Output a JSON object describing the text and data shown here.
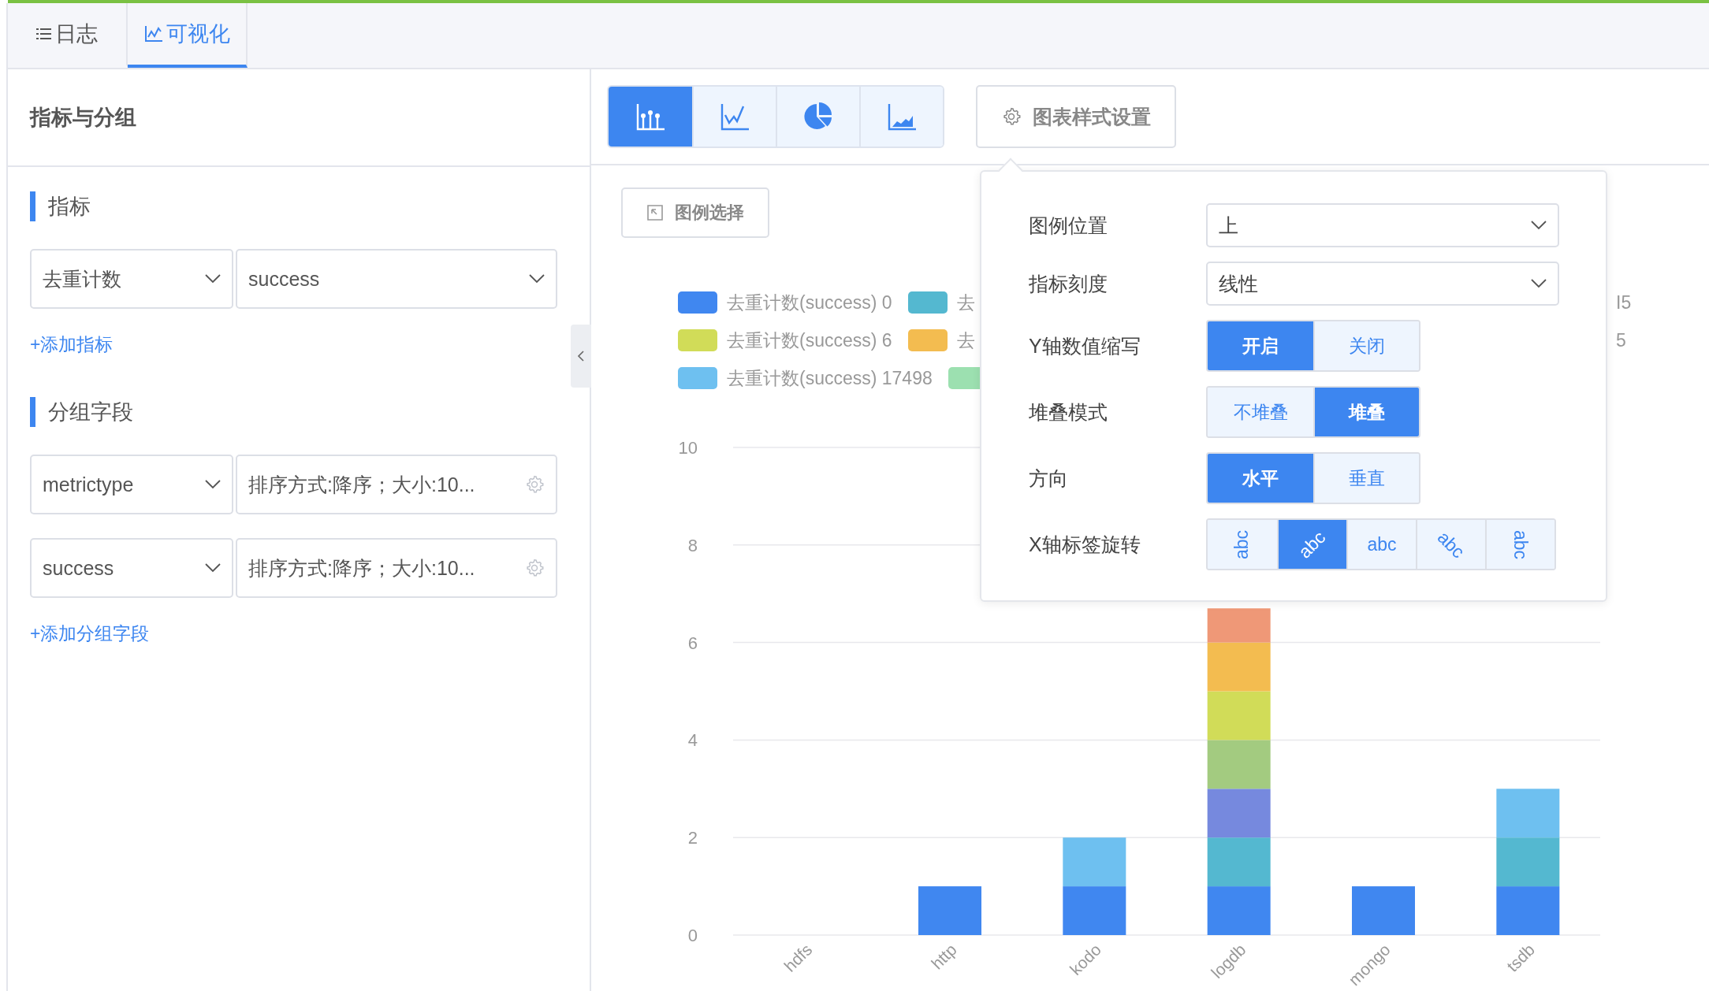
{
  "tabs": [
    {
      "label": "日志",
      "selected": false
    },
    {
      "label": "可视化",
      "selected": true
    }
  ],
  "left_panel": {
    "title": "指标与分组",
    "metrics": {
      "heading": "指标",
      "rows": [
        {
          "aggregate": "去重计数",
          "field": "success"
        }
      ],
      "add_link": "+添加指标"
    },
    "groups": {
      "heading": "分组字段",
      "rows": [
        {
          "field": "metrictype",
          "options": "排序方式:降序；大小:10..."
        },
        {
          "field": "success",
          "options": "排序方式:降序；大小:10..."
        }
      ],
      "add_link": "+添加分组字段"
    }
  },
  "chart_types": [
    {
      "kind": "bar",
      "selected": true
    },
    {
      "kind": "line",
      "selected": false
    },
    {
      "kind": "pie",
      "selected": false
    },
    {
      "kind": "area",
      "selected": false
    }
  ],
  "style_button": "图表样式设置",
  "legend_button": "图例选择",
  "legend": {
    "rows": [
      {
        "items": [
          {
            "label": "去重计数(success) 0",
            "color": "#4087f0"
          },
          {
            "label": "去",
            "color": "#54b8d0"
          }
        ],
        "tail": "I5"
      },
      {
        "items": [
          {
            "label": "去重计数(success) 6",
            "color": "#d1dc58"
          },
          {
            "label": "去",
            "color": "#f3bc50"
          }
        ],
        "tail": "5"
      },
      {
        "items": [
          {
            "label": "去重计数(success) 17498",
            "color": "#6ec0f0"
          },
          {
            "color": "#9ce0b0"
          }
        ]
      }
    ]
  },
  "chart_data": {
    "type": "bar",
    "stacked": true,
    "grid": true,
    "categories": [
      "hdfs",
      "http",
      "kodo",
      "logdb",
      "mongo",
      "tsdb"
    ],
    "ylim": [
      0,
      10
    ],
    "yticks": [
      0,
      2,
      4,
      6,
      8,
      10
    ],
    "series": [
      {
        "color": "#4087f0",
        "values": [
          0,
          1,
          1,
          1,
          1,
          1
        ]
      },
      {
        "color": "#54b8d0",
        "values": [
          0,
          0,
          0,
          1,
          0,
          1
        ]
      },
      {
        "color": "#6ec0f0",
        "values": [
          0,
          0,
          1,
          0,
          0,
          1
        ]
      },
      {
        "color": "#7689de",
        "values": [
          0,
          0,
          0,
          1,
          0,
          0
        ]
      },
      {
        "color": "#a3cb80",
        "values": [
          0,
          0,
          0,
          1,
          0,
          0
        ]
      },
      {
        "color": "#d1dc58",
        "values": [
          0,
          0,
          0,
          1,
          0,
          0
        ]
      },
      {
        "color": "#f3bc50",
        "values": [
          0,
          0,
          0,
          1,
          0,
          0
        ]
      },
      {
        "color": "#ef9877",
        "values": [
          0,
          0,
          0,
          0.7,
          0,
          0
        ]
      }
    ]
  },
  "style_popup": {
    "rows": [
      {
        "label": "图例位置",
        "kind": "select",
        "value": "上"
      },
      {
        "label": "指标刻度",
        "kind": "select",
        "value": "线性"
      },
      {
        "label": "Y轴数值缩写",
        "kind": "segmented",
        "options": [
          {
            "label": "开启",
            "selected": true
          },
          {
            "label": "关闭",
            "selected": false
          }
        ]
      },
      {
        "label": "堆叠模式",
        "kind": "segmented",
        "options": [
          {
            "label": "不堆叠",
            "selected": false
          },
          {
            "label": "堆叠",
            "selected": true
          }
        ]
      },
      {
        "label": "方向",
        "kind": "segmented",
        "options": [
          {
            "label": "水平",
            "selected": true
          },
          {
            "label": "垂直",
            "selected": false
          }
        ]
      },
      {
        "label": "X轴标签旋转",
        "kind": "rotation",
        "options": [
          {
            "label": "abc",
            "kind": "up",
            "selected": false
          },
          {
            "label": "abc",
            "kind": "diag-up",
            "selected": true
          },
          {
            "label": "abc",
            "kind": "flat",
            "selected": false
          },
          {
            "label": "abc",
            "kind": "diag-down",
            "selected": false
          },
          {
            "label": "abc",
            "kind": "down",
            "selected": false
          }
        ]
      }
    ]
  }
}
